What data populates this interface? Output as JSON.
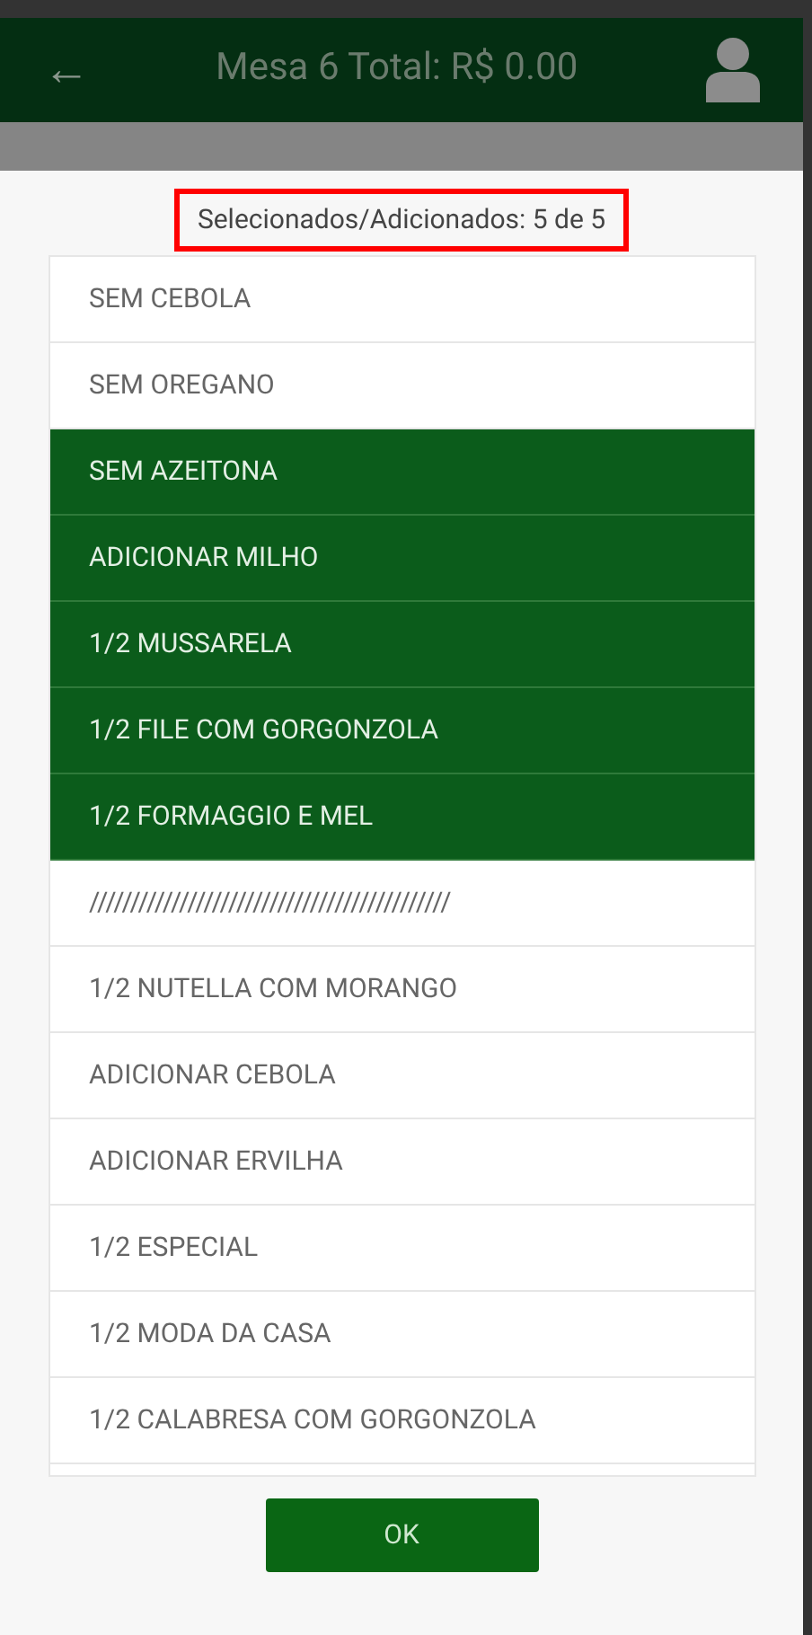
{
  "header": {
    "back": "←",
    "title": "Mesa 6 Total: R$ 0.00"
  },
  "dialog": {
    "counter": "Selecionados/Adicionados: 5 de 5",
    "options": [
      {
        "label": "SEM CEBOLA",
        "selected": false
      },
      {
        "label": "SEM OREGANO",
        "selected": false
      },
      {
        "label": "SEM AZEITONA",
        "selected": true
      },
      {
        "label": "ADICIONAR MILHO",
        "selected": true
      },
      {
        "label": "1/2 MUSSARELA",
        "selected": true
      },
      {
        "label": "1/2 FILE COM GORGONZOLA",
        "selected": true
      },
      {
        "label": "1/2 FORMAGGIO E MEL",
        "selected": true
      },
      {
        "label": "////////////////////////////////////////////",
        "selected": false
      },
      {
        "label": "1/2 NUTELLA COM MORANGO",
        "selected": false
      },
      {
        "label": "ADICIONAR CEBOLA",
        "selected": false
      },
      {
        "label": "ADICIONAR ERVILHA",
        "selected": false
      },
      {
        "label": "1/2 ESPECIAL",
        "selected": false
      },
      {
        "label": "1/2 MODA DA CASA",
        "selected": false
      },
      {
        "label": "1/2 CALABRESA COM GORGONZOLA",
        "selected": false
      }
    ],
    "ok_button": "OK"
  }
}
